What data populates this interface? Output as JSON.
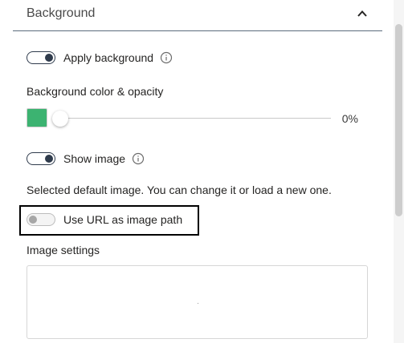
{
  "section": {
    "title": "Background",
    "chevron_icon": "chevron-up-icon"
  },
  "apply_background": {
    "label": "Apply background",
    "enabled": true,
    "info_icon": "info-icon"
  },
  "color_opacity": {
    "label": "Background color & opacity",
    "swatch_color": "#3cb371",
    "opacity_value": "0%",
    "opacity_level": 0
  },
  "show_image": {
    "label": "Show image",
    "enabled": true,
    "info_icon": "info-icon"
  },
  "image_description": "Selected default image. You can change it or load a new one.",
  "use_url": {
    "label": "Use URL as image path",
    "enabled": false
  },
  "image_settings": {
    "label": "Image settings"
  },
  "colors": {
    "accent": "#2f3b4c",
    "divider": "#5b6b7c"
  }
}
